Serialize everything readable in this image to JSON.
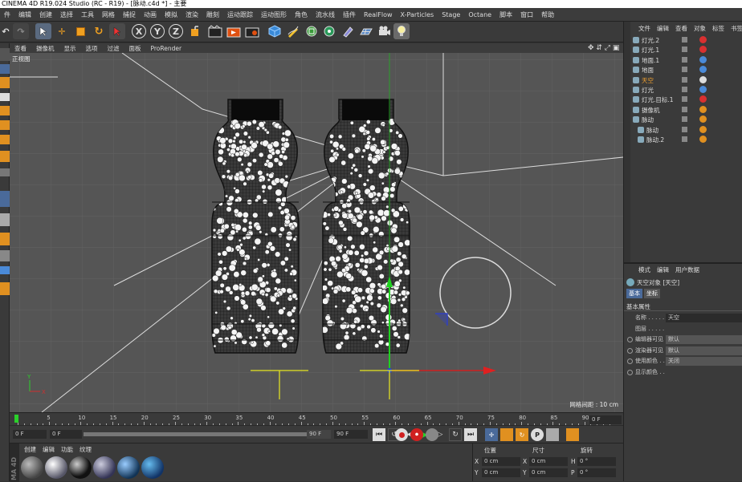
{
  "window": {
    "title": "CINEMA 4D R19.024 Studio (RC - R19) - [脉动.c4d *] - 主要"
  },
  "menubar": [
    "件",
    "编辑",
    "创建",
    "选择",
    "工具",
    "网格",
    "捕捉",
    "动画",
    "模拟",
    "渲染",
    "雕刻",
    "运动跟踪",
    "运动图形",
    "角色",
    "流水线",
    "插件",
    "RealFlow",
    "X-Particles",
    "Stage",
    "Octane",
    "脚本",
    "窗口",
    "帮助"
  ],
  "toolbar": {
    "axis_x": "X",
    "axis_y": "Y",
    "axis_z": "Z"
  },
  "viewport": {
    "menu": [
      "查看",
      "摄像机",
      "显示",
      "选项",
      "过滤",
      "面板",
      "ProRender"
    ],
    "label": "正视图",
    "grid_spacing": "网格间距 : 10 cm",
    "accent_colors": {
      "x_axis": "#e02020",
      "y_axis": "#20c020",
      "z_axis": "#2040e0",
      "selection": "#e8e820"
    }
  },
  "timeline": {
    "ticks": [
      "0",
      "5",
      "10",
      "15",
      "20",
      "25",
      "30",
      "35",
      "40",
      "45",
      "50",
      "55",
      "60",
      "65",
      "70",
      "75",
      "80",
      "85",
      "90"
    ],
    "current_frame": "0 F"
  },
  "transport": {
    "start": "0 F",
    "field2": "0 F",
    "end": "90 F",
    "end2": "90 F"
  },
  "materials": {
    "tabs": [
      "创建",
      "编辑",
      "功能",
      "纹理"
    ],
    "side_label": "MA 4D"
  },
  "coords": {
    "headers": [
      "位置",
      "尺寸",
      "旋转"
    ],
    "rows": [
      {
        "axis": "X",
        "pos": "0 cm",
        "size_axis": "X",
        "size": "0 cm",
        "rot_axis": "H",
        "rot": "0 °"
      },
      {
        "axis": "Y",
        "pos": "0 cm",
        "size_axis": "Y",
        "size": "0 cm",
        "rot_axis": "P",
        "rot": "0 °"
      }
    ]
  },
  "objects": {
    "menu": [
      "文件",
      "编辑",
      "查看",
      "对象",
      "标签",
      "书签"
    ],
    "items": [
      {
        "name": "灯光.2",
        "indent": 0,
        "color": "#ddd"
      },
      {
        "name": "灯光.1",
        "indent": 0,
        "color": "#ddd"
      },
      {
        "name": "地面.1",
        "indent": 0,
        "color": "#ddd"
      },
      {
        "name": "地面",
        "indent": 0,
        "color": "#ddd"
      },
      {
        "name": "天空",
        "indent": 0,
        "color": "#f0a030"
      },
      {
        "name": "灯光",
        "indent": 0,
        "color": "#ddd"
      },
      {
        "name": "灯光.目标.1",
        "indent": 0,
        "color": "#ddd"
      },
      {
        "name": "摄像机",
        "indent": 0,
        "color": "#ddd"
      },
      {
        "name": "脉动",
        "indent": 0,
        "color": "#ddd"
      },
      {
        "name": "脉动",
        "indent": 1,
        "color": "#ddd"
      },
      {
        "name": "脉动.2",
        "indent": 1,
        "color": "#ddd"
      }
    ]
  },
  "attributes": {
    "menu": [
      "模式",
      "编辑",
      "用户数据"
    ],
    "object_title": "天空对象 [天空]",
    "tabs": [
      "基本",
      "坐标"
    ],
    "section": "基本属性",
    "fields": [
      {
        "label": "名称 . . . . .",
        "value": "天空"
      },
      {
        "label": "图层 . . . . .",
        "value": ""
      },
      {
        "label": "编辑器可见",
        "value": "默认"
      },
      {
        "label": "渲染器可见",
        "value": "默认"
      },
      {
        "label": "使用颜色 . . .",
        "value": "关闭"
      },
      {
        "label": "显示颜色 . .",
        "value": ""
      }
    ]
  }
}
